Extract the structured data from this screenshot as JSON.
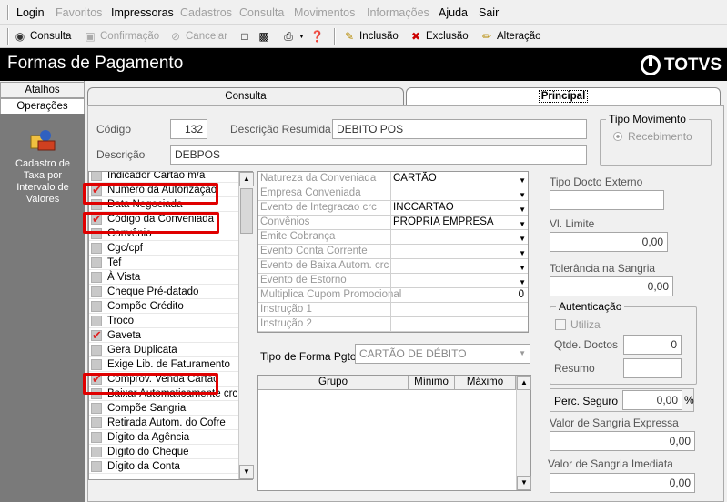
{
  "menu": {
    "items": [
      {
        "label": "Login",
        "enabled": true
      },
      {
        "label": "Favoritos",
        "enabled": false
      },
      {
        "label": "Impressoras",
        "enabled": true
      },
      {
        "label": "Cadastros",
        "enabled": false
      },
      {
        "label": "Consulta",
        "enabled": false
      },
      {
        "label": "Movimentos",
        "enabled": false
      },
      {
        "label": "Informações",
        "enabled": false
      },
      {
        "label": "Ajuda",
        "enabled": true
      },
      {
        "label": "Sair",
        "enabled": true
      }
    ]
  },
  "toolbar": {
    "consulta": "Consulta",
    "confirmacao": "Confirmação",
    "cancelar": "Cancelar",
    "inclusao": "Inclusão",
    "exclusao": "Exclusão",
    "alteracao": "Alteração"
  },
  "title": "Formas de Pagamento",
  "brand": "TOTVS",
  "left": {
    "tab_atalhos": "Atalhos",
    "tab_operacoes": "Operações",
    "shortcut_label": "Cadastro de Taxa por Intervalo de Valores"
  },
  "tabs": {
    "consulta": "Consulta",
    "principal": "Principal"
  },
  "form": {
    "codigo_label": "Código",
    "codigo_value": "132",
    "desc_resumida_label": "Descrição Resumida",
    "desc_resumida_value": "DEBITO POS",
    "descricao_label": "Descrição",
    "descricao_value": "DEBPOS",
    "tipo_movimento": {
      "title": "Tipo Movimento",
      "option": "Recebimento"
    },
    "tipo_forma_label": "Tipo de Forma Pgto",
    "tipo_forma_value": "CARTÃO DE DÉBITO"
  },
  "checklist": [
    {
      "label": "Indicador Cartao m/a",
      "checked": false
    },
    {
      "label": "Número da Autorização",
      "checked": true
    },
    {
      "label": "Data Negociada",
      "checked": false
    },
    {
      "label": "Código da Conveniada",
      "checked": true
    },
    {
      "label": "Convênio",
      "checked": false
    },
    {
      "label": "Cgc/cpf",
      "checked": false
    },
    {
      "label": "Tef",
      "checked": false
    },
    {
      "label": "À Vista",
      "checked": false
    },
    {
      "label": "Cheque Pré-datado",
      "checked": false
    },
    {
      "label": "Compõe Crédito",
      "checked": false
    },
    {
      "label": "Troco",
      "checked": false
    },
    {
      "label": "Gaveta",
      "checked": true
    },
    {
      "label": "Gera Duplicata",
      "checked": false
    },
    {
      "label": "Exige Lib. de Faturamento",
      "checked": false
    },
    {
      "label": "Comprov. Venda Cartão",
      "checked": true
    },
    {
      "label": "Baixar Automaticamente crc",
      "checked": false
    },
    {
      "label": "Compõe Sangria",
      "checked": false
    },
    {
      "label": "Retirada Autom. do Cofre",
      "checked": false
    },
    {
      "label": "Dígito da Agência",
      "checked": false
    },
    {
      "label": "Dígito do Cheque",
      "checked": false
    },
    {
      "label": "Dígito da Conta",
      "checked": false
    }
  ],
  "properties": [
    {
      "key": "Natureza da Conveniada",
      "value": "CARTÃO",
      "dropdown": true
    },
    {
      "key": "Empresa Conveniada",
      "value": "",
      "dropdown": true
    },
    {
      "key": "Evento de Integracao crc",
      "value": "INCCARTAO",
      "dropdown": true
    },
    {
      "key": "Convênios",
      "value": "PROPRIA EMPRESA",
      "dropdown": true
    },
    {
      "key": "Emite Cobrança",
      "value": "",
      "dropdown": true
    },
    {
      "key": "Evento Conta Corrente",
      "value": "",
      "dropdown": true
    },
    {
      "key": "Evento de Baixa Autom. crc",
      "value": "",
      "dropdown": true
    },
    {
      "key": "Evento de Estorno",
      "value": "",
      "dropdown": true
    },
    {
      "key": "Multiplica Cupom Promocional",
      "value": "0",
      "dropdown": false
    },
    {
      "key": "Instrução 1",
      "value": "",
      "dropdown": false
    },
    {
      "key": "Instrução 2",
      "value": "",
      "dropdown": false
    }
  ],
  "table": {
    "headers": [
      "Grupo",
      "Mínimo",
      "Máximo"
    ]
  },
  "side": {
    "tipo_docto_label": "Tipo Docto Externo",
    "tipo_docto_value": "",
    "vl_limite_label": "Vl. Limite",
    "vl_limite_value": "0,00",
    "tolerancia_label": "Tolerância na Sangria",
    "tolerancia_value": "0,00",
    "autenticacao_title": "Autenticação",
    "utiliza_label": "Utiliza",
    "qtde_docs_label": "Qtde. Doctos",
    "qtde_docs_value": "0",
    "resumo_label": "Resumo",
    "resumo_value": "",
    "perc_seguro_label": "Perc. Seguro",
    "perc_seguro_value": "0,00",
    "perc_symbol": "%",
    "sangria_expressa_label": "Valor de Sangria Expressa",
    "sangria_expressa_value": "0,00",
    "sangria_imediata_label": "Valor de Sangria Imediata",
    "sangria_imediata_value": "0,00"
  },
  "colors": {
    "highlight": "#e00000",
    "titlebar": "#000000",
    "check": "#e02020"
  }
}
